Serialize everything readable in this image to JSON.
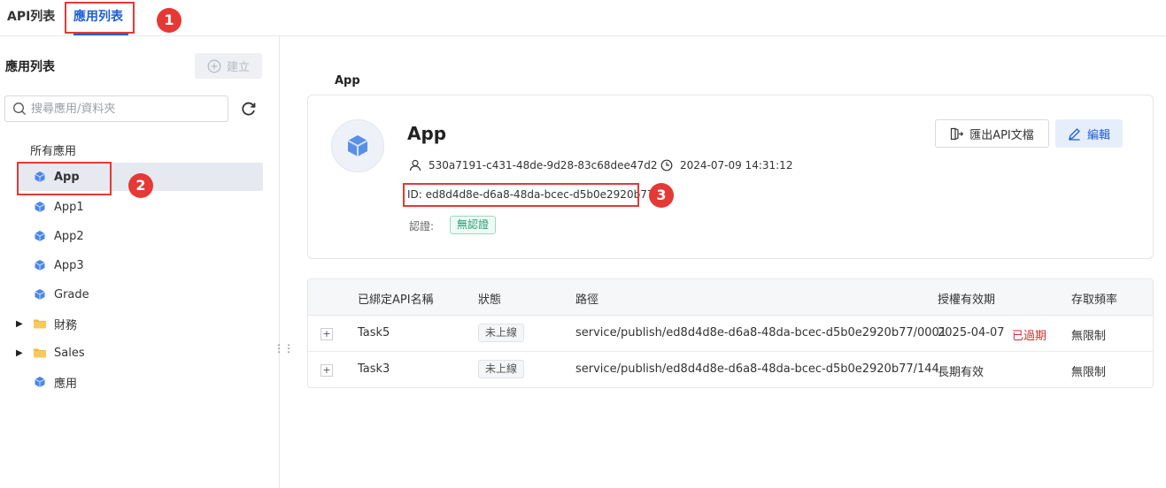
{
  "tabs": [
    {
      "label": "API列表"
    },
    {
      "label": "應用列表"
    }
  ],
  "annotations": [
    "1",
    "2",
    "3"
  ],
  "sidebar": {
    "title": "應用列表",
    "create_label": "建立",
    "search_placeholder": "搜尋應用/資料夾",
    "root_label": "所有應用",
    "items": [
      {
        "label": "App",
        "type": "app"
      },
      {
        "label": "App1",
        "type": "app"
      },
      {
        "label": "App2",
        "type": "app"
      },
      {
        "label": "App3",
        "type": "app"
      },
      {
        "label": "Grade",
        "type": "app"
      },
      {
        "label": "財務",
        "type": "folder"
      },
      {
        "label": "Sales",
        "type": "folder"
      },
      {
        "label": "應用",
        "type": "app"
      }
    ]
  },
  "main": {
    "title": "App",
    "app_name": "App",
    "owner": "530a7191-c431-48de-9d28-83c68dee47d2",
    "created_at": "2024-07-09 14:31:12",
    "id_text": "ID: ed8d4d8e-d6a8-48da-bcec-d5b0e2920b77",
    "auth_label": "認證:",
    "auth_value": "無認證",
    "export_label": "匯出API文檔",
    "edit_label": "編輯"
  },
  "table": {
    "headers": [
      "已綁定API名稱",
      "狀態",
      "路徑",
      "授權有效期",
      "存取頻率"
    ],
    "rows": [
      {
        "name": "Task5",
        "status": "未上線",
        "path": "service/publish/ed8d4d8e-d6a8-48da-bcec-d5b0e2920b77/0001",
        "validity": "2025-04-07",
        "validity_note": "已過期",
        "rate": "無限制"
      },
      {
        "name": "Task3",
        "status": "未上線",
        "path": "service/publish/ed8d4d8e-d6a8-48da-bcec-d5b0e2920b77/144",
        "validity": "長期有效",
        "validity_note": "",
        "rate": "無限制"
      }
    ]
  },
  "colors": {
    "accent": "#1f5fd1",
    "annotation": "#e53935",
    "expired": "#d32f2f",
    "auth_tag": "#2a9d74"
  }
}
